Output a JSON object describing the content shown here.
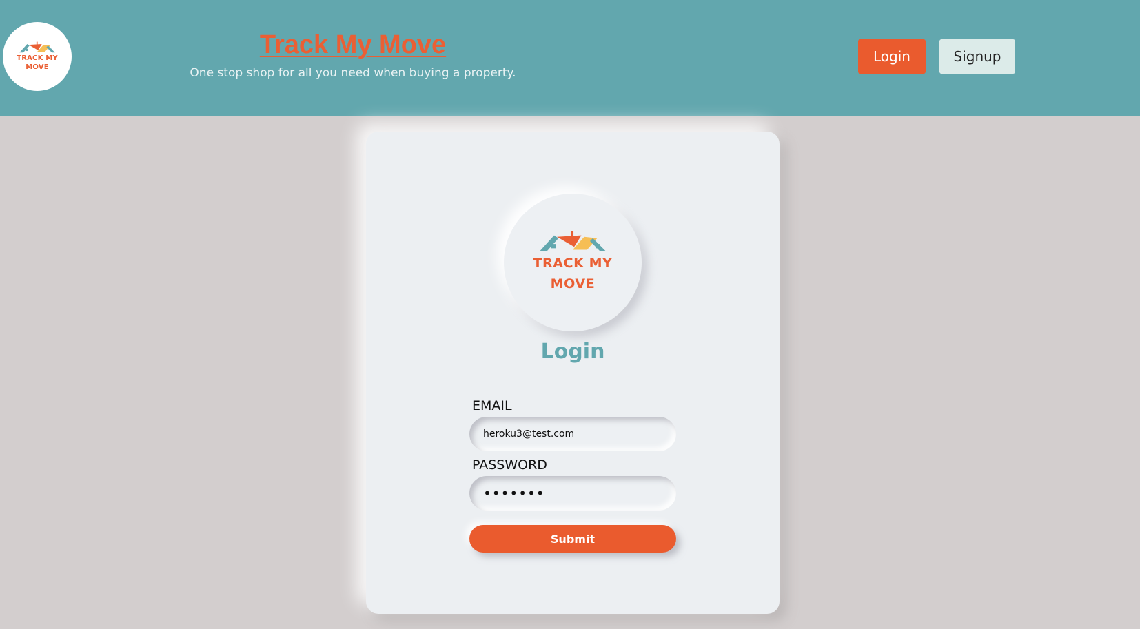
{
  "header": {
    "logo_line1": "TRACK MY",
    "logo_line2": "MOVE",
    "title": "Track My Move",
    "tagline": "One stop shop for all you need when buying a property.",
    "login_label": "Login",
    "signup_label": "Signup"
  },
  "card": {
    "logo_line1": "TRACK MY",
    "logo_line2": "MOVE",
    "title": "Login",
    "email_label": "EMAIL",
    "email_value": "heroku3@test.com",
    "password_label": "PASSWORD",
    "password_value": "•••••••",
    "submit_label": "Submit"
  },
  "colors": {
    "header_bg": "#62a7ae",
    "accent_orange": "#ea5b2e",
    "page_bg": "#d3cece",
    "card_bg": "#eceff2",
    "title_teal": "#62a7ae",
    "roof_yellow": "#f6be55"
  },
  "icons": {
    "logo_roof": "house-roof-logo-icon"
  }
}
